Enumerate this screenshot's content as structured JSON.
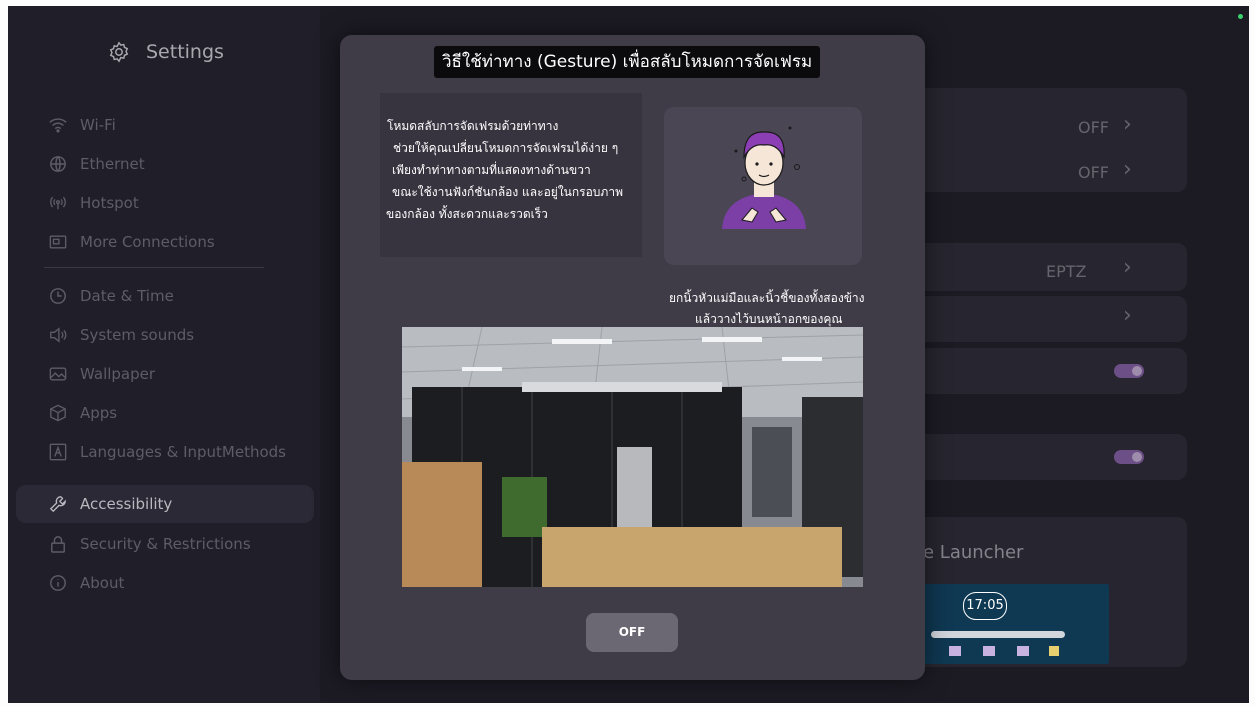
{
  "sidebar": {
    "title": "Settings",
    "items": [
      {
        "label": "Wi-Fi",
        "icon": "wifi-icon"
      },
      {
        "label": "Ethernet",
        "icon": "ethernet-icon"
      },
      {
        "label": "Hotspot",
        "icon": "hotspot-icon"
      },
      {
        "label": "More Connections",
        "icon": "connections-icon"
      },
      {
        "label": "Date & Time",
        "icon": "clock-icon"
      },
      {
        "label": "System sounds",
        "icon": "speaker-icon"
      },
      {
        "label": "Wallpaper",
        "icon": "image-icon"
      },
      {
        "label": "Apps",
        "icon": "cube-icon"
      },
      {
        "label": "Languages & InputMethods",
        "icon": "keyboard-icon"
      },
      {
        "label": "Accessibility",
        "icon": "wrench-icon"
      },
      {
        "label": "Security & Restrictions",
        "icon": "lock-icon"
      },
      {
        "label": "About",
        "icon": "info-icon"
      }
    ],
    "active": "Accessibility"
  },
  "content": {
    "row1_value": "OFF",
    "row2_value": "OFF",
    "row3_value": "EPTZ",
    "launcher_label": "e Launcher",
    "thumbnail_time": "17:05"
  },
  "dialog": {
    "title": "วิธีใช้ท่าทาง (Gesture) เพื่อสลับโหมดการจัดเฟรม",
    "description": [
      "โหมดสลับการจัดเฟรมด้วยท่าทาง",
      "ช่วยให้คุณเปลี่ยนโหมดการจัดเฟรมได้ง่าย ๆ",
      "เพียงทำท่าทางตามที่แสดงทางด้านขวา",
      "ขณะใช้งานฟังก์ชันกล้อง และอยู่ในกรอบภาพ",
      "ของกล้อง ทั้งสะดวกและรวดเร็ว"
    ],
    "caption": [
      "ยกนิ้วหัวแม่มือและนิ้วชี้ของทั้งสองข้าง",
      "แล้ววางไว้บนหน้าอกของคุณ"
    ],
    "button_label": "OFF"
  },
  "colors": {
    "accent": "#6d4f87",
    "background": "#1f1d27",
    "dialog": "#3f3c47",
    "status_dot": "#3bd26b"
  }
}
